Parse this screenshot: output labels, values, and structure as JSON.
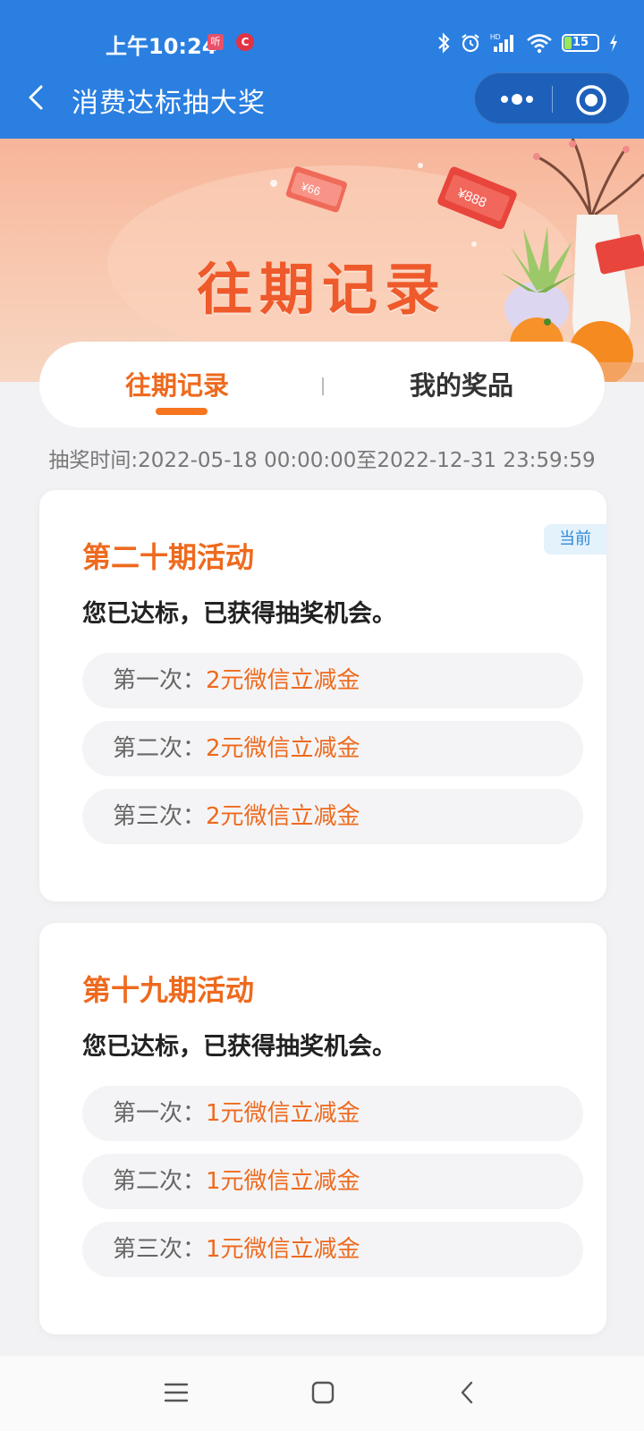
{
  "status_bar": {
    "time": "上午10:24",
    "notif1": "听",
    "notif2": "C",
    "battery": "15"
  },
  "nav": {
    "title": "消费达标抽大奖"
  },
  "banner": {
    "title": "往期记录"
  },
  "tabs": [
    {
      "label": "往期记录",
      "active": true
    },
    {
      "label": "我的奖品",
      "active": false
    }
  ],
  "draw_time": "抽奖时间:2022-05-18 00:00:00至2022-12-31 23:59:59",
  "periods": [
    {
      "title": "第二十期活动",
      "badge": "当前",
      "subtitle": "您已达标，已获得抽奖机会。",
      "draws": [
        {
          "label": "第一次：",
          "value": "2元微信立减金"
        },
        {
          "label": "第二次：",
          "value": "2元微信立减金"
        },
        {
          "label": "第三次：",
          "value": "2元微信立减金"
        }
      ]
    },
    {
      "title": "第十九期活动",
      "subtitle": "您已达标，已获得抽奖机会。",
      "draws": [
        {
          "label": "第一次：",
          "value": "1元微信立减金"
        },
        {
          "label": "第二次：",
          "value": "1元微信立减金"
        },
        {
          "label": "第三次：",
          "value": "1元微信立减金"
        }
      ]
    }
  ],
  "colors": {
    "header_blue": "#2a7fe0",
    "accent_orange": "#ee6a1e",
    "badge_bg": "#e4f2fc",
    "badge_text": "#2e8ad8"
  }
}
